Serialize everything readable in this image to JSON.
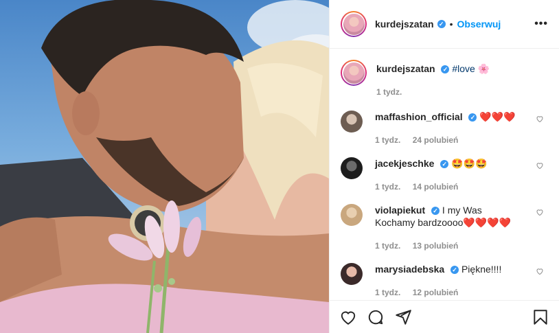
{
  "header": {
    "username": "kurdejszatan",
    "dot": "•",
    "follow_label": "Obserwuj",
    "more_icon": "more-dots-icon"
  },
  "caption": {
    "username": "kurdejszatan",
    "hashtag": "#love",
    "emoji": "🌸",
    "time": "1 tydz."
  },
  "comments": [
    {
      "username": "maffashion_official",
      "text": "❤️❤️❤️",
      "time": "1 tydz.",
      "likes": "24 polubień"
    },
    {
      "username": "jacekjeschke",
      "text": "🤩🤩🤩",
      "time": "1 tydz.",
      "likes": "14 polubień"
    },
    {
      "username": "violapiekut",
      "text": "I my Was Kochamy bardzoooo❤️❤️❤️❤️",
      "time": "1 tydz.",
      "likes": "13 polubień"
    },
    {
      "username": "marysiadebska",
      "text": "Piękne!!!!",
      "time": "1 tydz.",
      "likes": "12 polubień"
    }
  ],
  "actions": {
    "like_icon": "heart-icon",
    "comment_icon": "comment-icon",
    "share_icon": "share-icon",
    "save_icon": "bookmark-icon"
  },
  "colors": {
    "accent": "#0095f6",
    "verified": "#3897f0",
    "muted": "#8e8e8e",
    "text": "#262626"
  }
}
